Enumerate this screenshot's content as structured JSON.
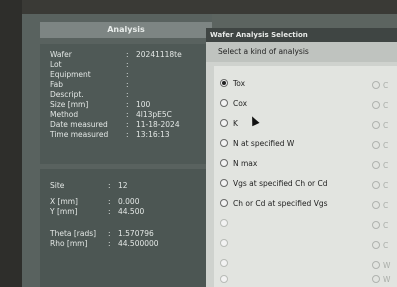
{
  "analysis": {
    "title": "Analysis",
    "wafer_info": [
      {
        "label": "Wafer",
        "value": "20241118te"
      },
      {
        "label": "Lot",
        "value": ""
      },
      {
        "label": "Equipment",
        "value": ""
      },
      {
        "label": "Fab",
        "value": ""
      },
      {
        "label": "Descript.",
        "value": ""
      },
      {
        "label": "Size [mm]",
        "value": "100"
      },
      {
        "label": "Method",
        "value": "4l13pE5C"
      },
      {
        "label": "Date measured",
        "value": "11-18-2024"
      },
      {
        "label": "Time measured",
        "value": "13:16:13"
      }
    ],
    "site_info": [
      {
        "label": "Site",
        "value": "12"
      },
      {
        "label": "X [mm]",
        "value": "0.000"
      },
      {
        "label": "Y [mm]",
        "value": "44.500"
      },
      {
        "label": "Theta [rads]",
        "value": "1.570796"
      },
      {
        "label": "Rho [mm]",
        "value": "44.500000"
      }
    ]
  },
  "dialog": {
    "title": "Wafer Analysis Selection",
    "subtitle": "Select a kind of analysis",
    "options": [
      {
        "label": "Tox",
        "selected": true,
        "enabled": true
      },
      {
        "label": "Cox",
        "selected": false,
        "enabled": true
      },
      {
        "label": "K",
        "selected": false,
        "enabled": true
      },
      {
        "label": "N at specified W",
        "selected": false,
        "enabled": true
      },
      {
        "label": "N max",
        "selected": false,
        "enabled": true
      },
      {
        "label": "Vgs at specified Ch or Cd",
        "selected": false,
        "enabled": true
      },
      {
        "label": "Ch or Cd at specified Vgs",
        "selected": false,
        "enabled": true
      },
      {
        "label": "",
        "selected": false,
        "enabled": false
      },
      {
        "label": "",
        "selected": false,
        "enabled": false
      },
      {
        "label": "",
        "selected": false,
        "enabled": false
      },
      {
        "label": "",
        "selected": false,
        "enabled": false
      }
    ],
    "right_column": [
      "C",
      "C",
      "C",
      "C",
      "C",
      "C",
      "C",
      "C",
      "C",
      "W",
      "W"
    ]
  }
}
